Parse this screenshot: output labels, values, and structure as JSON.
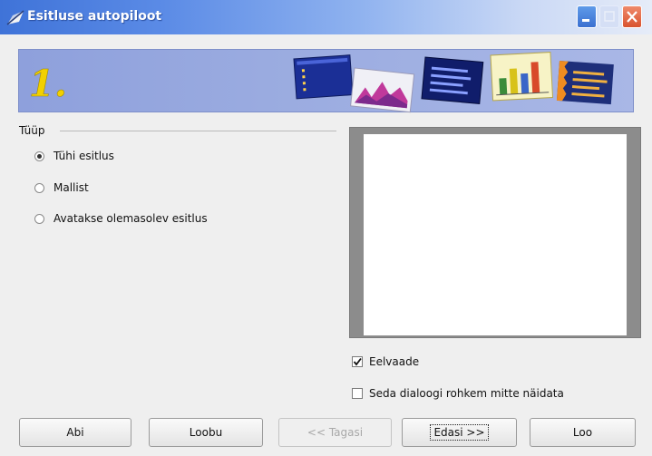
{
  "window": {
    "title": "Esitluse autopiloot",
    "icon": "draw-app-icon",
    "controls": [
      "minimize-icon",
      "maximize-icon",
      "close-icon"
    ]
  },
  "banner": {
    "step": "1.",
    "images": [
      "slide-blue-icon",
      "chart-area-icon",
      "slide-dark-icon",
      "bar-chart-icon",
      "slide-orange-icon"
    ]
  },
  "type_group": {
    "label": "Tüüp",
    "options": [
      {
        "label": "Tühi esitlus",
        "selected": true
      },
      {
        "label": "Mallist",
        "selected": false
      },
      {
        "label": "Avatakse olemasolev esitlus",
        "selected": false
      }
    ]
  },
  "preview": {
    "checkbox_label": "Eelvaade",
    "checked": true
  },
  "dont_show": {
    "checkbox_label": "Seda dialoogi rohkem mitte näidata",
    "checked": false
  },
  "buttons": {
    "help": "Abi",
    "cancel": "Loobu",
    "back": "<< Tagasi",
    "next": "Edasi >>",
    "create": "Loo"
  },
  "colors": {
    "titlebar": "#3f73d8",
    "banner": "#9aabe0",
    "step_number": "#f2d000"
  }
}
